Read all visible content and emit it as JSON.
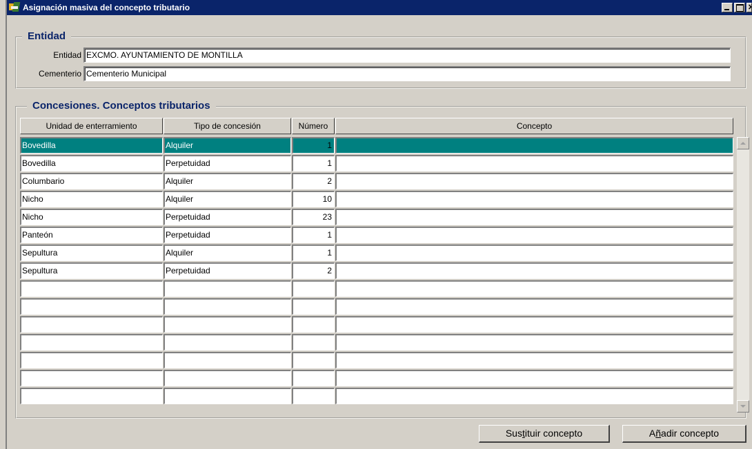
{
  "window": {
    "title": "Asignación masiva del concepto tributario"
  },
  "entidad_group": {
    "title": "Entidad",
    "entidad_label": "Entidad",
    "entidad_value": "EXCMO. AYUNTAMIENTO DE MONTILLA",
    "cementerio_label": "Cementerio",
    "cementerio_value": "Cementerio Municipal"
  },
  "concesiones_group": {
    "title": "Concesiones. Conceptos tributarios",
    "columns": [
      "Unidad de enterramiento",
      "Tipo de concesión",
      "Número",
      "Concepto"
    ],
    "rows": [
      {
        "unidad": "Bovedilla",
        "tipo": "Alquiler",
        "numero": "1",
        "concepto": "",
        "selected": true
      },
      {
        "unidad": "Bovedilla",
        "tipo": "Perpetuidad",
        "numero": "1",
        "concepto": ""
      },
      {
        "unidad": "Columbario",
        "tipo": "Alquiler",
        "numero": "2",
        "concepto": ""
      },
      {
        "unidad": "Nicho",
        "tipo": "Alquiler",
        "numero": "10",
        "concepto": ""
      },
      {
        "unidad": "Nicho",
        "tipo": "Perpetuidad",
        "numero": "23",
        "concepto": ""
      },
      {
        "unidad": "Panteón",
        "tipo": "Perpetuidad",
        "numero": "1",
        "concepto": ""
      },
      {
        "unidad": "Sepultura",
        "tipo": "Alquiler",
        "numero": "1",
        "concepto": ""
      },
      {
        "unidad": "Sepultura",
        "tipo": "Perpetuidad",
        "numero": "2",
        "concepto": ""
      },
      {
        "unidad": "",
        "tipo": "",
        "numero": "",
        "concepto": ""
      },
      {
        "unidad": "",
        "tipo": "",
        "numero": "",
        "concepto": ""
      },
      {
        "unidad": "",
        "tipo": "",
        "numero": "",
        "concepto": ""
      },
      {
        "unidad": "",
        "tipo": "",
        "numero": "",
        "concepto": ""
      },
      {
        "unidad": "",
        "tipo": "",
        "numero": "",
        "concepto": ""
      },
      {
        "unidad": "",
        "tipo": "",
        "numero": "",
        "concepto": ""
      },
      {
        "unidad": "",
        "tipo": "",
        "numero": "",
        "concepto": ""
      }
    ]
  },
  "buttons": {
    "sustituir_pre": "Sus",
    "sustituir_key": "t",
    "sustituir_post": "ituir concepto",
    "anadir_pre": "A",
    "anadir_key": "ñ",
    "anadir_post": "adir concepto"
  },
  "colors": {
    "titlebar": "#0a246a",
    "selected_row": "#008080",
    "group_title": "#0a246a"
  },
  "icons": {
    "app": "app-icon",
    "minimize": "minimize-icon",
    "maximize": "maximize-icon",
    "close": "close-icon"
  }
}
